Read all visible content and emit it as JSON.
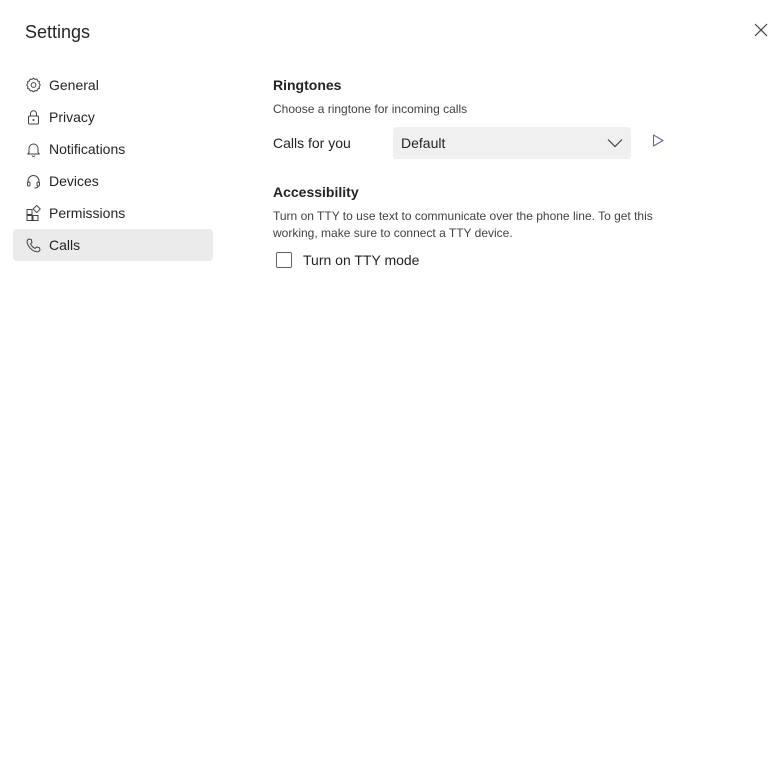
{
  "dialog": {
    "title": "Settings",
    "close_icon": "close-icon"
  },
  "sidebar": {
    "items": [
      {
        "label": "General",
        "icon": "gear-icon"
      },
      {
        "label": "Privacy",
        "icon": "lock-icon"
      },
      {
        "label": "Notifications",
        "icon": "bell-icon"
      },
      {
        "label": "Devices",
        "icon": "headset-icon"
      },
      {
        "label": "Permissions",
        "icon": "apps-icon"
      },
      {
        "label": "Calls",
        "icon": "phone-icon"
      }
    ],
    "active_item": "Calls"
  },
  "ringtones": {
    "title": "Ringtones",
    "description": "Choose a ringtone for incoming calls",
    "calls_for_you_label": "Calls for you",
    "selected_ringtone": "Default",
    "play_icon": "play-icon"
  },
  "accessibility": {
    "title": "Accessibility",
    "description": "Turn on TTY to use text to communicate over the phone line. To get this working, make sure to connect a TTY device.",
    "tty_label": "Turn on TTY mode",
    "tty_checked": false
  },
  "colors": {
    "active_bg": "#ebebeb",
    "select_bg": "#f0f0f0",
    "accent": "#6264a7",
    "text": "#242424"
  }
}
